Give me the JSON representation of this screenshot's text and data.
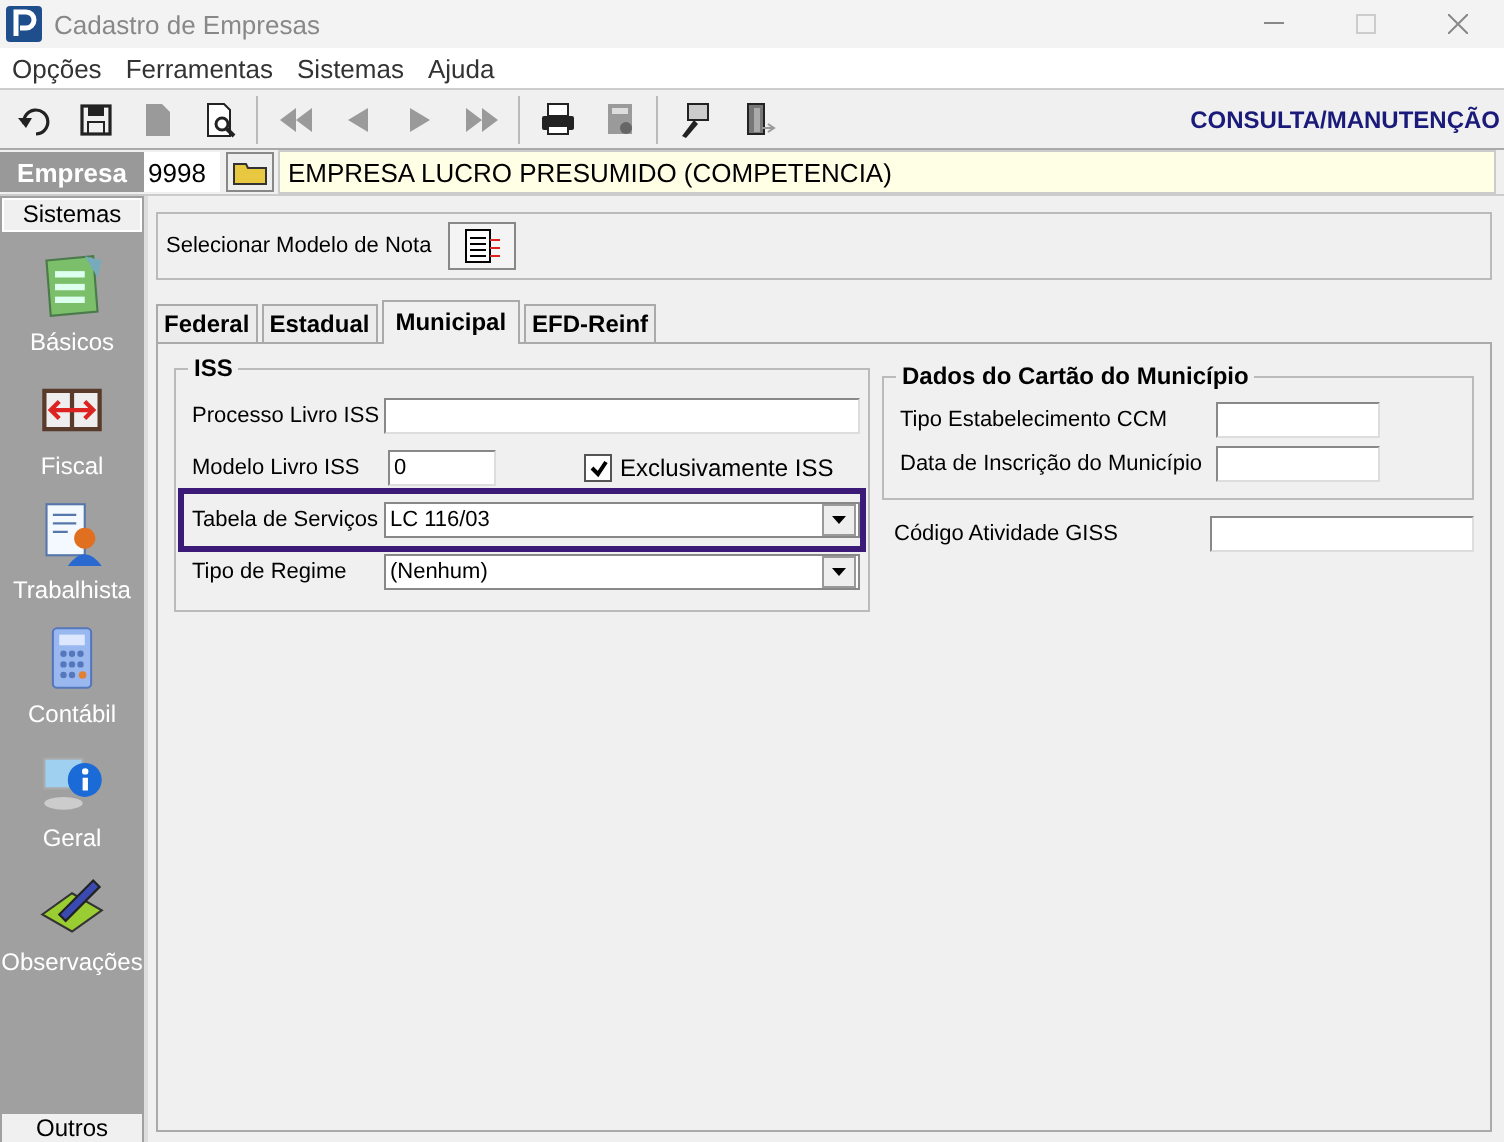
{
  "window": {
    "title": "Cadastro de Empresas"
  },
  "menu": [
    "Opções",
    "Ferramentas",
    "Sistemas",
    "Ajuda"
  ],
  "toolbar": [
    {
      "kind": "undo",
      "disabled": false
    },
    {
      "kind": "save",
      "disabled": false
    },
    {
      "kind": "document",
      "disabled": true
    },
    {
      "kind": "preview",
      "disabled": false
    },
    {
      "kind": "sep"
    },
    {
      "kind": "first",
      "disabled": true
    },
    {
      "kind": "prev",
      "disabled": true
    },
    {
      "kind": "next",
      "disabled": true
    },
    {
      "kind": "last",
      "disabled": true
    },
    {
      "kind": "sep"
    },
    {
      "kind": "print",
      "disabled": false
    },
    {
      "kind": "calc",
      "disabled": true
    },
    {
      "kind": "sep"
    },
    {
      "kind": "tool",
      "disabled": false
    },
    {
      "kind": "exit",
      "disabled": false
    }
  ],
  "mode_label": "CONSULTA/MANUTENÇÃO",
  "empresa": {
    "label": "Empresa",
    "code": "9998",
    "name": "EMPRESA LUCRO PRESUMIDO (COMPETENCIA)"
  },
  "sidebar": {
    "header": "Sistemas",
    "items": [
      {
        "label": "Básicos",
        "kind": "basicos"
      },
      {
        "label": "Fiscal",
        "kind": "fiscal"
      },
      {
        "label": "Trabalhista",
        "kind": "trabalhista"
      },
      {
        "label": "Contábil",
        "kind": "contabil"
      },
      {
        "label": "Geral",
        "kind": "geral"
      },
      {
        "label": "Observações",
        "kind": "observacoes"
      }
    ],
    "footer": "Outros"
  },
  "modelo_nota": {
    "label": "Selecionar Modelo de Nota"
  },
  "tabs": [
    {
      "label": "Federal",
      "selected": false
    },
    {
      "label": "Estadual",
      "selected": false
    },
    {
      "label": "Municipal",
      "selected": true
    },
    {
      "label": "EFD-Reinf",
      "selected": false
    }
  ],
  "iss": {
    "title": "ISS",
    "processo_livro": {
      "label": "Processo Livro ISS"
    },
    "modelo_livro": {
      "label": "Modelo Livro ISS",
      "value": "0"
    },
    "exclusivamente": {
      "label": "Exclusivamente ISS",
      "checked": true
    },
    "tabela_servicos": {
      "label": "Tabela de Serviços",
      "value": "LC 116/03",
      "highlighted": true
    },
    "tipo_regime": {
      "label": "Tipo de Regime",
      "value": "(Nenhum)"
    }
  },
  "dados_cartao": {
    "title": "Dados do Cartão do Município",
    "fields": [
      {
        "label": "Tipo Estabelecimento CCM"
      },
      {
        "label": "Data de Inscrição do Município"
      }
    ]
  },
  "codigo_giss": {
    "label": "Código Atividade GISS"
  }
}
